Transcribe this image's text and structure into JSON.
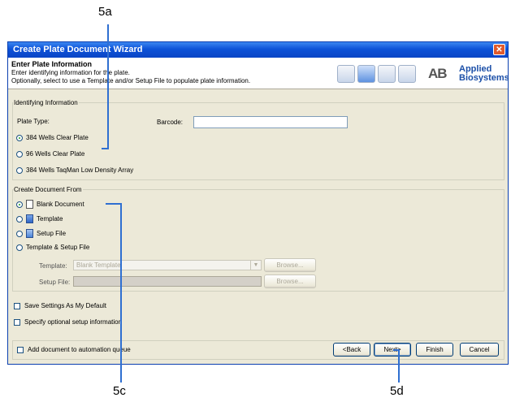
{
  "callouts": {
    "top": "5a",
    "left_bottom": "5c",
    "right_bottom": "5d"
  },
  "window": {
    "title": "Create Plate Document Wizard",
    "close_glyph": "✕"
  },
  "header": {
    "title": "Enter Plate Information",
    "desc1": "Enter identifying information for the plate.",
    "desc2": "Optionally, select to use a Template and/or Setup File to populate plate information.",
    "logo_mark": "AB",
    "logo_line1": "Applied",
    "logo_line2": "Biosystems",
    "icons": [
      "document-icon",
      "template-icon",
      "settings-icon",
      "image-icon"
    ]
  },
  "identifying": {
    "legend": "Identifying Information",
    "plate_type_label": "Plate Type:",
    "barcode_label": "Barcode:",
    "barcode_value": "",
    "options": [
      "384 Wells Clear Plate",
      "96 Wells Clear Plate",
      "384 Wells TaqMan Low Density Array"
    ],
    "selected": "384 Wells Clear Plate"
  },
  "create_from": {
    "legend": "Create Document From",
    "options": [
      "Blank Document",
      "Template",
      "Setup File",
      "Template & Setup File"
    ],
    "selected": "Blank Document",
    "template_label": "Template:",
    "template_value": "Blank Template",
    "setup_label": "Setup File:",
    "browse_label": "Browse..."
  },
  "checks": {
    "save_default": "Save Settings As My Default",
    "optional_setup": "Specify optional setup information",
    "automation": "Add document to automation queue"
  },
  "buttons": {
    "back": "<Back",
    "next": "Next>",
    "finish": "Finish",
    "cancel": "Cancel"
  },
  "colors": {
    "titlebar": "#0d52d8",
    "callout_line": "#2f6fd1",
    "dialog_bg": "#ece9d8"
  }
}
